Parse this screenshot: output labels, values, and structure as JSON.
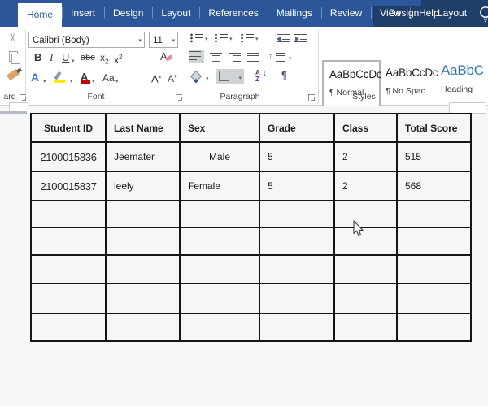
{
  "colors": {
    "ribbon_blue": "#2b579a",
    "contextual_tab_bg": "#1f3e6a",
    "active_tab_text": "#2b579a",
    "heading_style_blue": "#2e74b5",
    "highlight_yellow": "#ffe912",
    "font_color_red": "#c00000",
    "table_border": "#161616",
    "document_bg": "#f5f6f8",
    "pressed_button_bg": "#d0d3d6"
  },
  "tab_bar": {
    "tabs": [
      "Home",
      "Insert",
      "Design",
      "Layout",
      "References",
      "Mailings",
      "Review",
      "View",
      "Help"
    ],
    "active_tab": "Home",
    "contextual_tabs": [
      "Design",
      "Layout"
    ],
    "tell_me_icon": "lightbulb"
  },
  "ribbon": {
    "dropdown_glyph": "▾",
    "clipboard": {
      "visible_label": "ard",
      "cut_icon": "✂"
    },
    "font": {
      "label": "Font",
      "font_name_value": "Calibri (Body)",
      "font_size_value": "11",
      "bold": "B",
      "italic": "I",
      "underline": "U",
      "strikethrough": "abc",
      "subscript_base": "x",
      "subscript_mark": "2",
      "superscript_base": "x",
      "superscript_mark": "2",
      "clear_formatting": "A",
      "text_effects": "A",
      "font_color": "A",
      "change_case": "Aa",
      "grow_font": "A",
      "shrink_font": "A",
      "grow_mark": "▴",
      "shrink_mark": "▾"
    },
    "paragraph": {
      "label": "Paragraph",
      "sort_a": "A",
      "sort_z": "Z",
      "sort_arrow": "↓",
      "line_spacing_arrow": "↕",
      "pilcrow": "¶"
    },
    "styles": {
      "label": "Styles",
      "items": [
        {
          "preview": "AaBbCcDc",
          "caption": "¶ Normal",
          "selected": true
        },
        {
          "preview": "AaBbCcDc",
          "caption": "¶ No Spac...",
          "selected": false
        },
        {
          "preview": "AaBbC",
          "caption": "Heading",
          "selected": false
        }
      ]
    }
  },
  "table": {
    "headers": [
      "Student ID",
      "Last Name",
      "Sex",
      "Grade",
      "Class",
      "Total Score"
    ],
    "rows": [
      [
        "2100015836",
        "Jeemater",
        "Male",
        "5",
        "2",
        "515"
      ],
      [
        "2100015837",
        "leely",
        "Female",
        "5",
        "2",
        "568"
      ],
      [
        "",
        "",
        "",
        "",
        "",
        ""
      ],
      [
        "",
        "",
        "",
        "",
        "",
        ""
      ],
      [
        "",
        "",
        "",
        "",
        "",
        ""
      ],
      [
        "",
        "",
        "",
        "",
        "",
        ""
      ],
      [
        "",
        "",
        "",
        "",
        "",
        ""
      ]
    ]
  }
}
